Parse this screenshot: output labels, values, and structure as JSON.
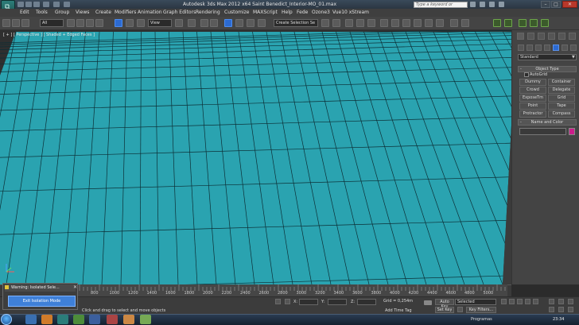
{
  "window": {
    "title": "Autodesk 3ds Max  2012 x64     Saint Benedict_Interior-MO_01.max",
    "search_placeholder": "Type a keyword or phrase",
    "min": "–",
    "max": "□",
    "close": "✕"
  },
  "menubar": [
    "Edit",
    "Tools",
    "Group",
    "Views",
    "Create",
    "Modifiers",
    "Animation",
    "Graph Editors",
    "Rendering",
    "Customize",
    "MAXScript",
    "Help",
    "Fede",
    "Ozone3",
    "Vue10 xStream"
  ],
  "toolbar": {
    "filter_value": "All",
    "view_value": "View",
    "selection_set_placeholder": "Create Selection Se"
  },
  "viewport": {
    "label": "[ + ] [ Perspective ] [ Shaded + Edged Faces ]",
    "floor_color": "#2aa3b0",
    "wire_color": "#0d2f36"
  },
  "command_panel": {
    "category_value": "Standard",
    "object_type_title": "Object Type",
    "autogrid_label": "AutoGrid",
    "buttons": [
      [
        "Dummy",
        "Container"
      ],
      [
        "Crowd",
        "Delegate"
      ],
      [
        "ExposeTm",
        "Grid"
      ],
      [
        "Point",
        "Tape"
      ],
      [
        "Protractor",
        "Compass"
      ]
    ],
    "name_color_title": "Name and Color",
    "object_color": "#cc1d8a"
  },
  "timeline": {
    "ticks": [
      "800",
      "1000",
      "1200",
      "1400",
      "1600",
      "1800",
      "2000",
      "2200",
      "2400",
      "2600",
      "2800",
      "3000",
      "3200",
      "3400",
      "3600",
      "3800",
      "4000",
      "4200",
      "4400",
      "4600",
      "4800",
      "5000"
    ]
  },
  "status": {
    "message": "Click and drag to select and move objects",
    "x_label": "X:",
    "y_label": "Y:",
    "z_label": "Z:",
    "grid": "Grid = 0,254m",
    "add_time_tag": "Add Time Tag",
    "auto_key": "Auto Key",
    "set_key": "Set Key",
    "selected_value": "Selected",
    "key_filters": "Key Filters..."
  },
  "warning_dialog": {
    "title": "Warning: Isolated Sele...",
    "close": "✕",
    "button": "Exit Isolation Mode"
  },
  "taskbar": {
    "language": "Programas",
    "clock": "23:34"
  }
}
